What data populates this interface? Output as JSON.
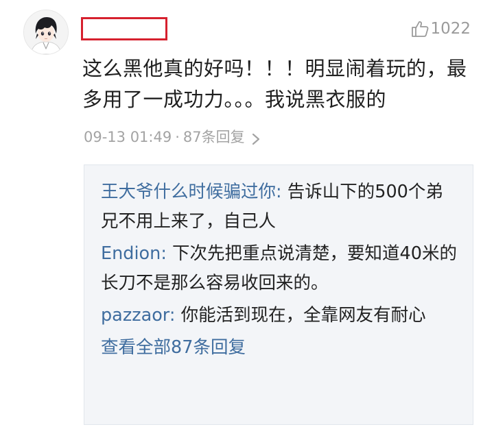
{
  "comment": {
    "likes": "1022",
    "text": "这么黑他真的好吗！！！明显闹着玩的，最多用了一成功力。。。我说黑衣服的",
    "timestamp": "09-13 01:49",
    "separator": "·",
    "reply_count_label": "87条回复"
  },
  "replies": [
    {
      "author": "王大爷什么时候骗过你",
      "colon": ": ",
      "text": "告诉山下的500个弟兄不用上来了，自己人"
    },
    {
      "author": "Endion",
      "colon": ": ",
      "text": "下次先把重点说清楚，要知道40米的长刀不是那么容易收回来的。"
    },
    {
      "author": "pazzaor",
      "colon": ": ",
      "text": "你能活到现在，全靠网友有耐心"
    }
  ],
  "view_all_label": "查看全部87条回复",
  "icons": {
    "like": "thumbs-up-icon",
    "chevron": "chevron-right-icon"
  },
  "colors": {
    "highlight_box": "#d6202e",
    "link_blue": "#3f6d9f",
    "meta_gray": "#a3a3a3",
    "reply_bg": "#f3f5f8"
  }
}
